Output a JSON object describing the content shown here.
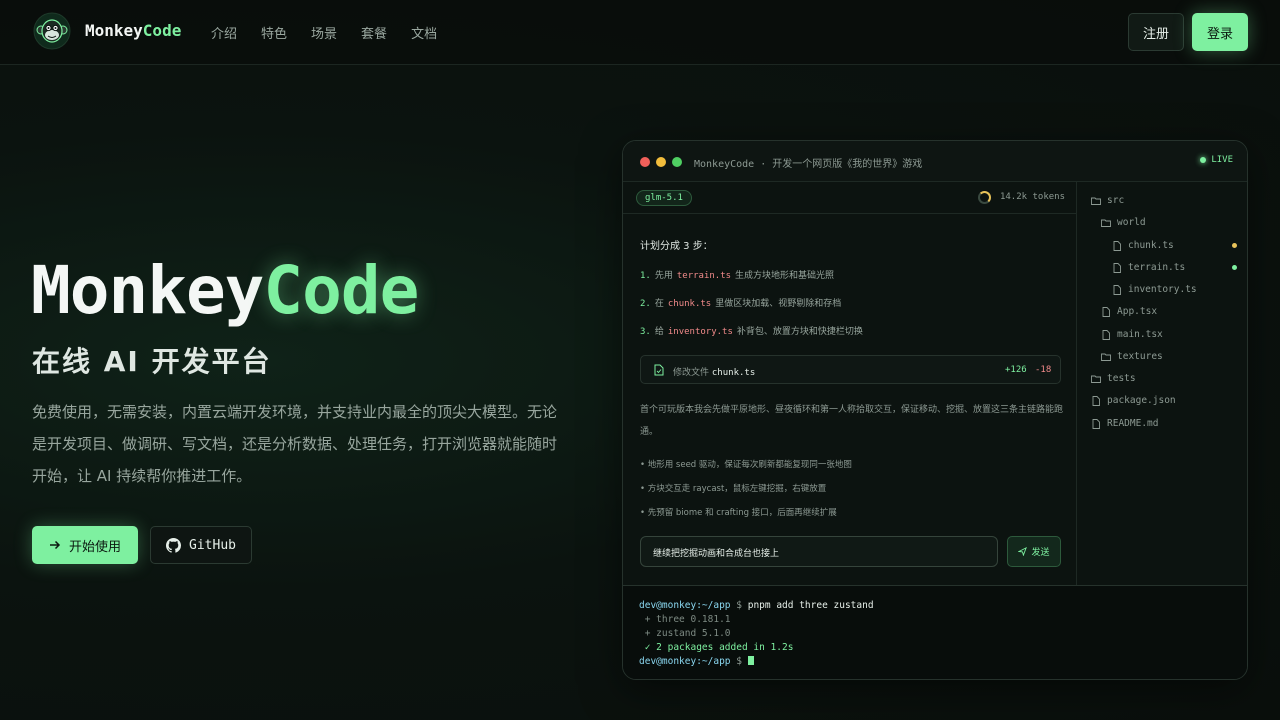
{
  "header": {
    "brand_main": "Monkey",
    "brand_accent": "Code",
    "nav": [
      "介绍",
      "特色",
      "场景",
      "套餐",
      "文档"
    ],
    "register_label": "注册",
    "login_label": "登录"
  },
  "hero": {
    "title_main": "Monkey",
    "title_accent": "Code",
    "subtitle": "在线 AI 开发平台",
    "description": "免费使用，无需安装，内置云端开发环境，并支持业内最全的顶尖大模型。无论是开发项目、做调研、写文档，还是分析数据、处理任务，打开浏览器就能随时开始，让 AI 持续帮你推进工作。",
    "start_label": "开始使用",
    "github_label": "GitHub"
  },
  "window": {
    "title": "MonkeyCode · 开发一个网页版《我的世界》游戏",
    "live": "LIVE",
    "model": "glm-5.1",
    "tokens": "14.2k tokens",
    "plan_title": "计划分成 3 步：",
    "steps": [
      {
        "num": "1.",
        "pre": "先用",
        "code": "terrain.ts",
        "post": "生成方块地形和基础光照"
      },
      {
        "num": "2.",
        "pre": "在",
        "code": "chunk.ts",
        "post": "里做区块加载、视野剔除和存档"
      },
      {
        "num": "3.",
        "pre": "给",
        "code": "inventory.ts",
        "post": "补背包、放置方块和快捷栏切换"
      }
    ],
    "modified_label": "修改文件",
    "modified_file": "chunk.ts",
    "modified_add": "+126",
    "modified_del": "-18",
    "paragraph": "首个可玩版本我会先做平原地形、昼夜循环和第一人称拾取交互，保证移动、挖掘、放置这三条主链路能跑通。",
    "bullets": [
      "• 地形用 seed 驱动，保证每次刷新都能复现同一张地图",
      "• 方块交互走 raycast，鼠标左键挖掘，右键放置",
      "• 先预留 biome 和 crafting 接口，后面再继续扩展"
    ],
    "input_value": "继续把挖掘动画和合成台也接上",
    "send_label": "发送"
  },
  "file_tree": [
    {
      "name": "src",
      "type": "folder"
    },
    {
      "name": "world",
      "type": "folder"
    },
    {
      "name": "chunk.ts",
      "type": "file",
      "status": "modified"
    },
    {
      "name": "terrain.ts",
      "type": "file",
      "status": "added"
    },
    {
      "name": "inventory.ts",
      "type": "file"
    },
    {
      "name": "App.tsx",
      "type": "file"
    },
    {
      "name": "main.tsx",
      "type": "file"
    },
    {
      "name": "textures",
      "type": "folder"
    },
    {
      "name": "tests",
      "type": "folder"
    },
    {
      "name": "package.json",
      "type": "file"
    },
    {
      "name": "README.md",
      "type": "file"
    }
  ],
  "terminal": {
    "prompt": "dev@monkey:~/app",
    "dollar": "$",
    "command": "pnpm add three zustand",
    "out1": " + three 0.181.1",
    "out2": " + zustand 5.1.0",
    "out3": " ✓ 2 packages added in 1.2s"
  },
  "colors": {
    "accent": "#7ef0a0",
    "background": "#0b130f",
    "code_highlight": "#f08a8a",
    "prompt": "#8ad7f0",
    "modified_marker": "#e8c35a"
  }
}
